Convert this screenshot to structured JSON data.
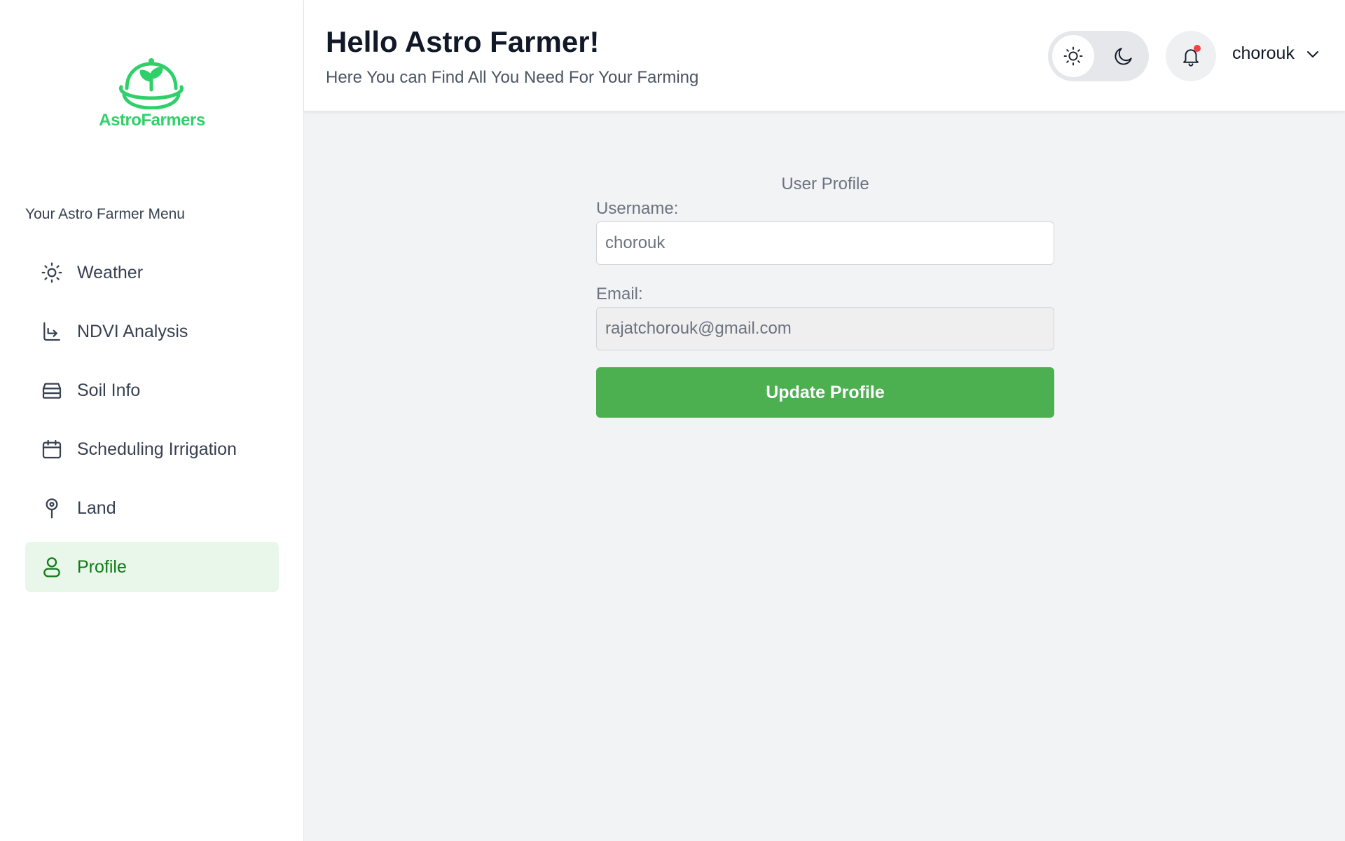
{
  "brand": {
    "name": "AstroFarmers",
    "color": "#2fd06a"
  },
  "sidebar": {
    "menu_title": "Your Astro Farmer Menu",
    "items": [
      {
        "label": "Weather",
        "icon": "sun-icon",
        "active": false
      },
      {
        "label": "NDVI Analysis",
        "icon": "download-tray-icon",
        "active": false
      },
      {
        "label": "Soil Info",
        "icon": "layers-icon",
        "active": false
      },
      {
        "label": "Scheduling Irrigation",
        "icon": "calendar-icon",
        "active": false
      },
      {
        "label": "Land",
        "icon": "map-pin-icon",
        "active": false
      },
      {
        "label": "Profile",
        "icon": "user-icon",
        "active": true
      }
    ],
    "active_color": "#0f7a17",
    "active_bg": "#e9f6ea"
  },
  "header": {
    "greeting": "Hello Astro Farmer!",
    "subtitle": "Here You can Find All You Need For Your Farming",
    "theme_toggle": {
      "options": [
        "light",
        "dark"
      ],
      "selected": "light"
    },
    "notifications": {
      "unread": true
    },
    "user": {
      "name": "chorouk"
    }
  },
  "profile": {
    "title": "User Profile",
    "username_label": "Username:",
    "username_value": "chorouk",
    "email_label": "Email:",
    "email_value": "rajatchorouk@gmail.com",
    "submit_label": "Update Profile",
    "submit_color": "#4caf50"
  }
}
